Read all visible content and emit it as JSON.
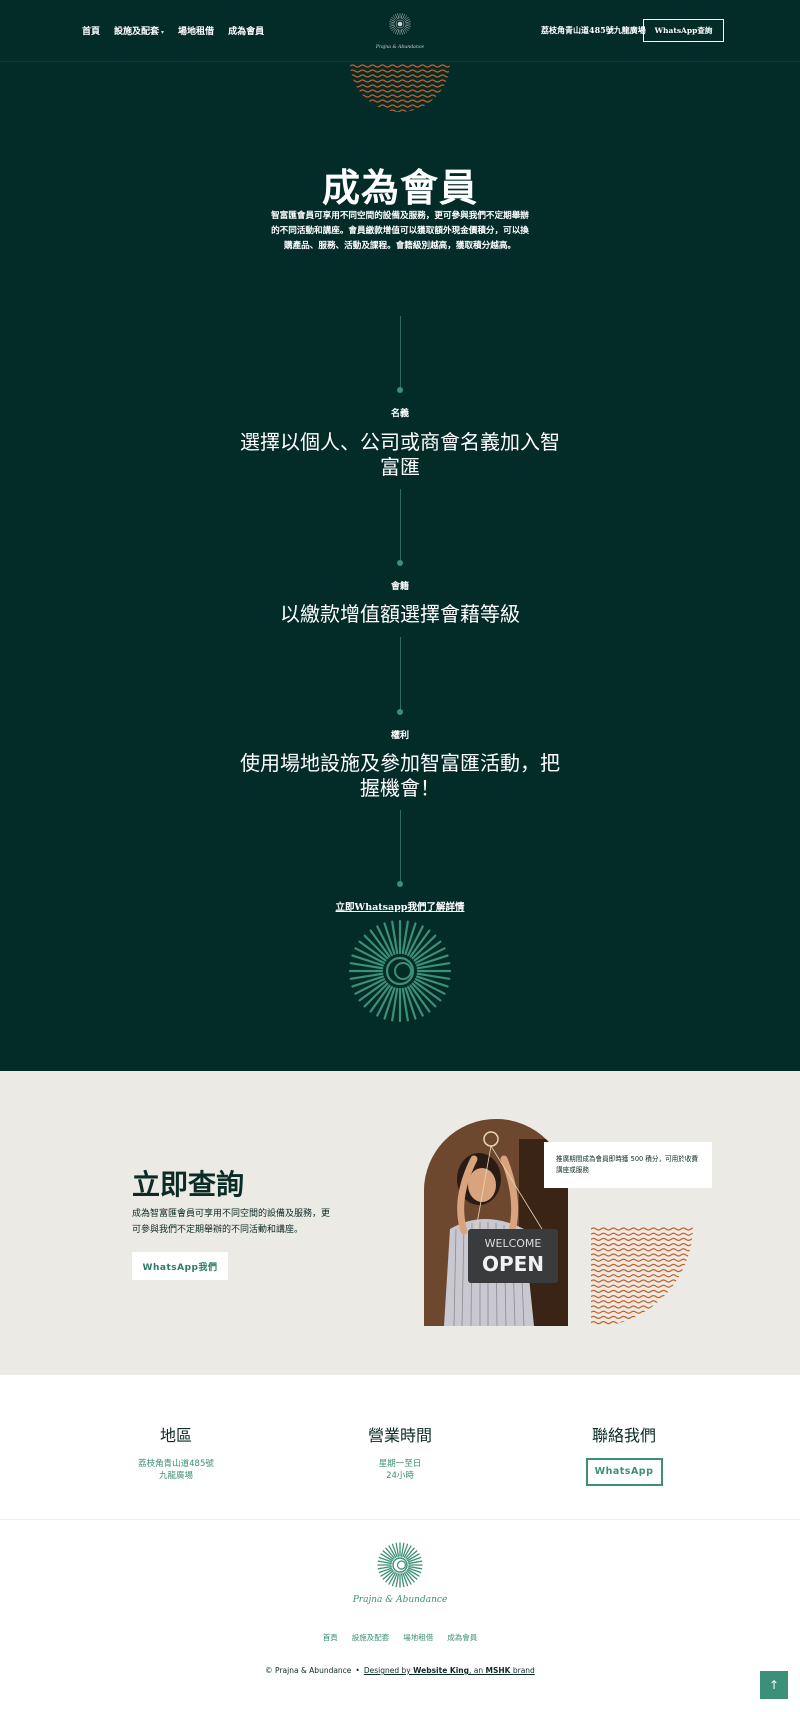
{
  "nav": {
    "items": [
      {
        "label": "首頁"
      },
      {
        "label": "設施及配套"
      },
      {
        "label": "場地租借"
      },
      {
        "label": "成為會員"
      }
    ],
    "address": "荔枝角青山道485號九龍廣場",
    "cta_label": "WhatsApp查詢",
    "logo_text": "Prajna & Abundance"
  },
  "hero": {
    "title": "成為會員",
    "description": "智富匯會員可享用不同空間的設備及服務，更可參與我們不定期舉辦的不同活動和講座。會員繳款增值可以獲取額外現金價積分，可以換購產品、服務、活動及課程。會籍級別越高，獲取積分越高。",
    "steps": [
      {
        "label": "名義",
        "text": "選擇以個人、公司或商會名義加入智富匯"
      },
      {
        "label": "會籍",
        "text": "以繳款增值額選擇會藉等級"
      },
      {
        "label": "權利",
        "text": "使用場地設施及參加智富匯活動，把握機會！"
      }
    ],
    "link_label": "立即Whatsapp我們了解詳情"
  },
  "enquiry": {
    "title": "立即查詢",
    "description": "成為智富匯會員可享用不同空間的設備及服務，更可參與我們不定期舉辦的不同活動和講座。",
    "button_label": "WhatsApp我們",
    "note": "推廣期間成為會員即時獲 500 積分，可用於收費講座或服務",
    "photo_sign_top": "WELCOME",
    "photo_sign_main": "OPEN"
  },
  "info": {
    "location": {
      "title": "地區",
      "line1": "荔枝角青山道485號",
      "line2": "九龍廣場"
    },
    "hours": {
      "title": "營業時間",
      "line1": "星期一至日",
      "line2": "24小時"
    },
    "contact": {
      "title": "聯絡我們",
      "button_label": "WhatsApp"
    }
  },
  "footer": {
    "logo_text": "Prajna & Abundance",
    "links": [
      {
        "label": "首頁"
      },
      {
        "label": "設施及配套"
      },
      {
        "label": "場地租借"
      },
      {
        "label": "成為會員"
      }
    ],
    "copyright": "© Prajna & Abundance",
    "separator": "•",
    "credit_prefix": "Designed by ",
    "credit_brand": "Website King",
    "credit_mid": ", an ",
    "credit_parent": "MSHK",
    "credit_suffix": " brand",
    "to_top_icon": "↑"
  },
  "colors": {
    "hero_bg": "#032b28",
    "accent_green": "#3c8f78",
    "wave_orange": "#c8602a",
    "enquiry_bg": "#eceae5"
  }
}
